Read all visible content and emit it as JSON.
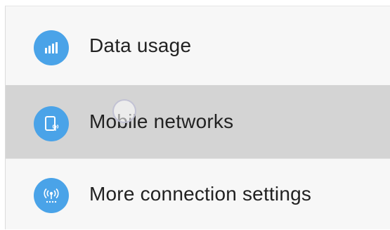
{
  "settings": {
    "items": [
      {
        "label": "Data usage",
        "icon": "bar-chart-icon"
      },
      {
        "label": "Mobile networks",
        "icon": "mobile-signal-icon",
        "state": "pressed"
      },
      {
        "label": "More connection settings",
        "icon": "antenna-icon"
      }
    ]
  },
  "colors": {
    "icon_bg": "#4aa3e8",
    "pressed_row_bg": "#d4d4d4",
    "panel_bg": "#f7f7f7",
    "text": "#222222"
  }
}
